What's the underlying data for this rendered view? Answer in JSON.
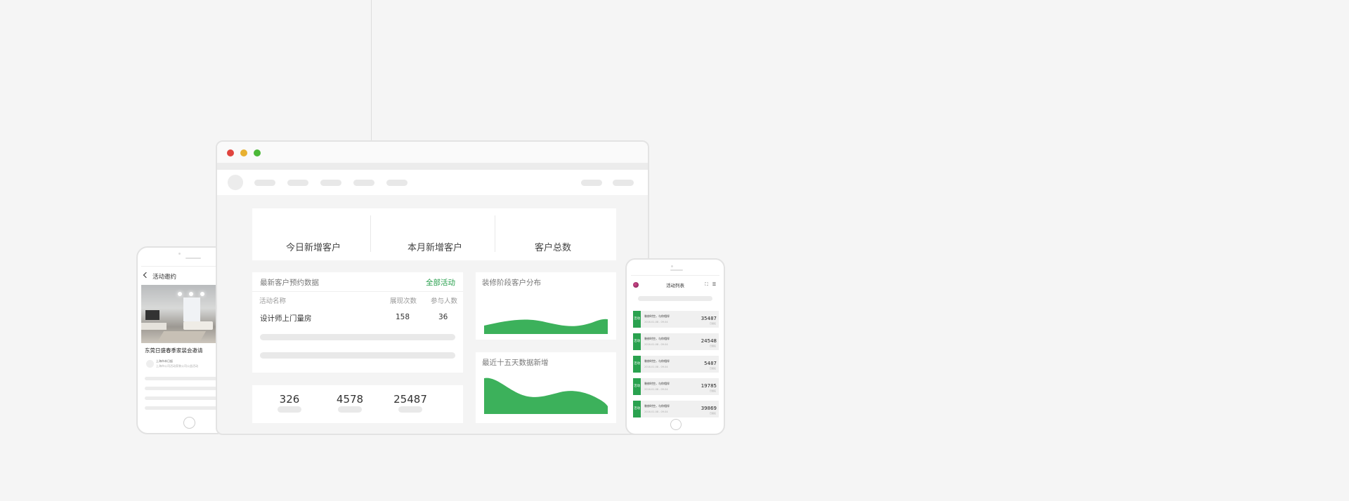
{
  "tablet": {
    "title": "活动邀约",
    "headline": "东莞日盛春季家装会邀请",
    "meta_line1": "上海市本日起",
    "meta_line2": "上海市公司活动家装公司公益活动"
  },
  "browser": {
    "stats": [
      "今日新增客户",
      "本月新增客户",
      "客户总数"
    ],
    "appointments": {
      "title": "最新客户预约数据",
      "link": "全部活动",
      "columns": [
        "活动名称",
        "展现次数",
        "参与人数"
      ],
      "rows": [
        {
          "name": "设计师上门量房",
          "views": "158",
          "participants": "36"
        }
      ]
    },
    "numbers": [
      "326",
      "4578",
      "25487"
    ],
    "stage_chart": {
      "title": "装修阶段客户分布",
      "color": "#3cb15b"
    },
    "growth_chart": {
      "title": "最近十五天数据新增",
      "color": "#3cb15b"
    }
  },
  "phone": {
    "title": "活动列表",
    "badge": "活动",
    "items": [
      {
        "text": "装修时空，与你相伴",
        "date": "2016.01.08 - 09.04",
        "count": "35487",
        "note": "已报名"
      },
      {
        "text": "装修时空，与你相伴",
        "date": "2016.01.08 - 09.04",
        "count": "24548",
        "note": "已报名"
      },
      {
        "text": "装修时空，与你相伴",
        "date": "2016.01.08 - 09.04",
        "count": "5487",
        "note": "已报名"
      },
      {
        "text": "装修时空，与你相伴",
        "date": "2016.01.08 - 09.04",
        "count": "19785",
        "note": "已报名"
      },
      {
        "text": "装修时空，与你相伴",
        "date": "2016.01.08 - 09.04",
        "count": "39869",
        "note": "已报名"
      }
    ]
  }
}
